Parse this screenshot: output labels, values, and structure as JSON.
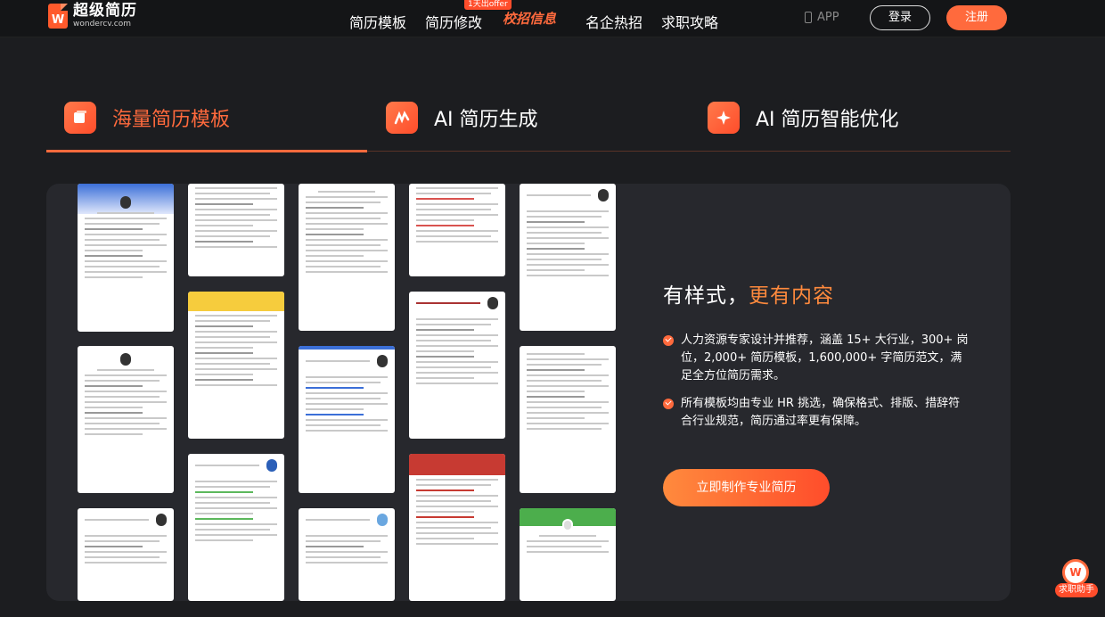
{
  "logo": {
    "title": "超级简历",
    "subtitle": "wondercv.com",
    "mark": "W"
  },
  "nav": {
    "items": [
      "简历模板",
      "简历修改",
      "校招信息",
      "名企热招",
      "求职攻略"
    ],
    "badge": "1天出offer",
    "app": "APP",
    "login": "登录",
    "register": "注册"
  },
  "tabs": [
    {
      "label": "海量简历模板",
      "icon": "document-icon",
      "active": true
    },
    {
      "label": "AI 简历生成",
      "icon": "wand-icon",
      "active": false
    },
    {
      "label": "AI 简历智能优化",
      "icon": "sparkle-icon",
      "active": false
    }
  ],
  "feature": {
    "headline_plain": "有样式，",
    "headline_highlight": "更有内容",
    "bullets": [
      "人力资源专家设计并推荐，涵盖 15+ 大行业，300+ 岗位，2,000+ 简历模板，1,600,000+ 字简历范文，满足全方位简历需求。",
      "所有模板均由专业 HR 挑选，确保格式、排版、措辞符合行业规范，简历通过率更有保障。"
    ],
    "cta": "立即制作专业简历"
  },
  "assistant": {
    "label": "求职助手",
    "mark": "W"
  },
  "colors": {
    "accent": "#ff6a3d",
    "background": "#1c1d20",
    "panel": "#27282d"
  }
}
